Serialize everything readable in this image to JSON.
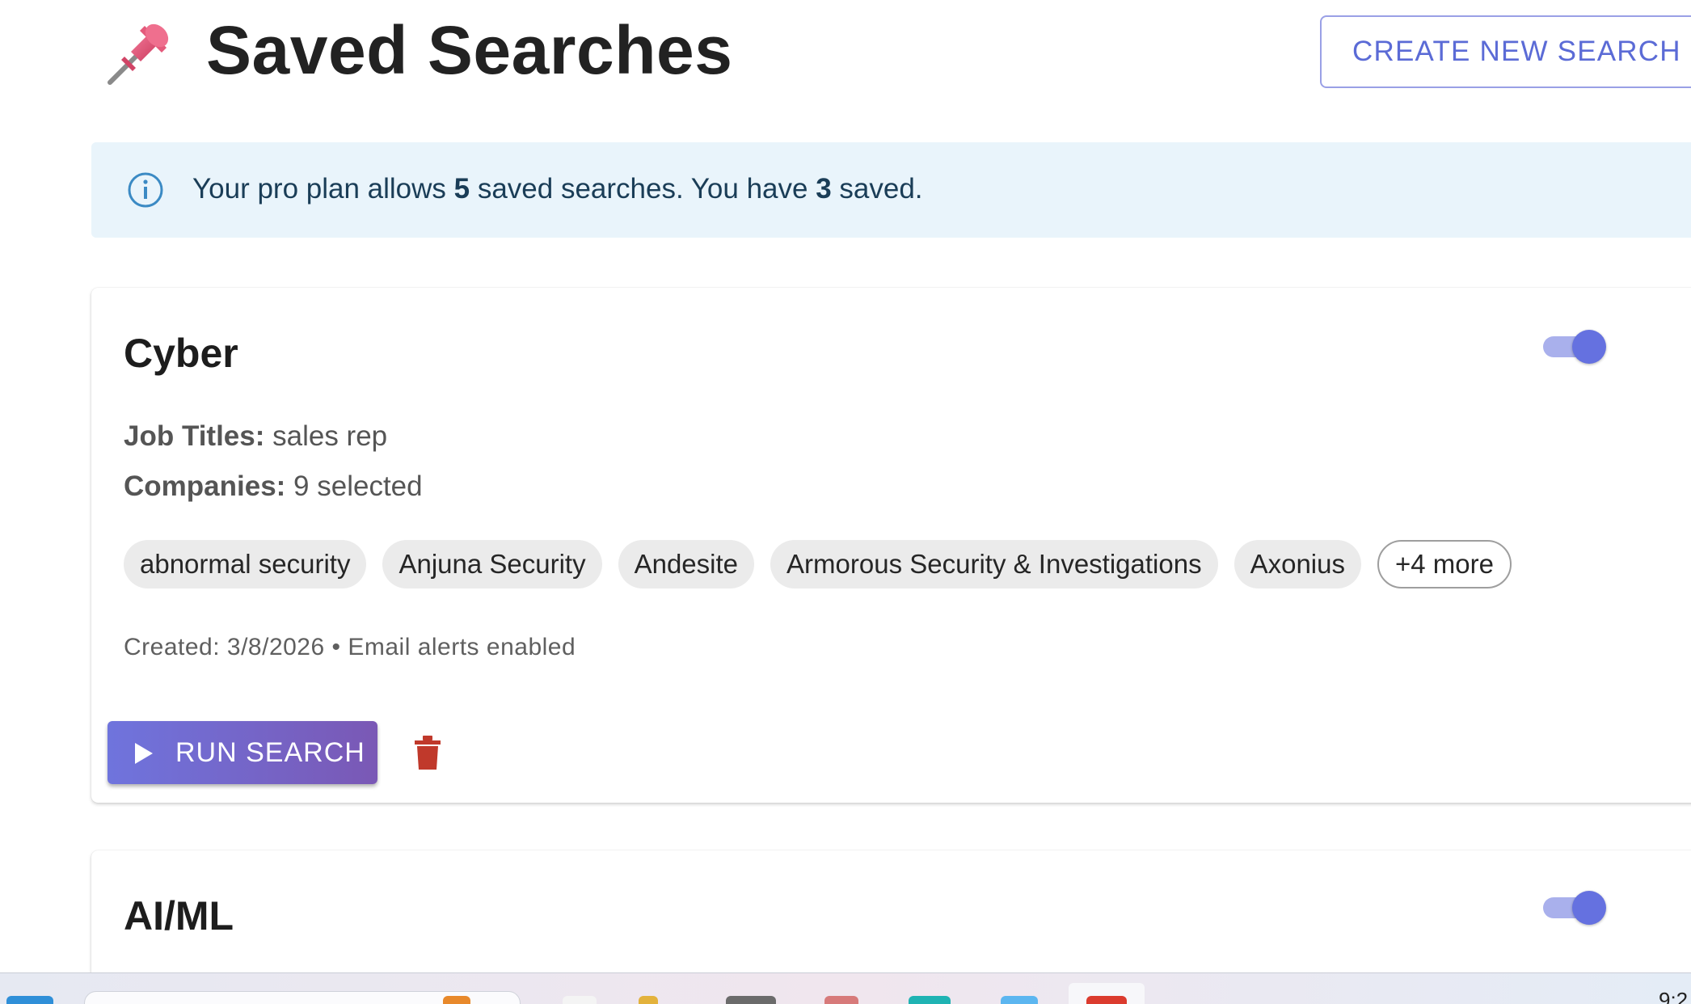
{
  "header": {
    "title": "Saved Searches",
    "pin_icon": "pushpin-icon",
    "create_button": "CREATE NEW SEARCH"
  },
  "info_banner": {
    "text_before": "Your pro plan allows ",
    "allowed": "5",
    "text_middle": " saved searches. You have ",
    "saved": "3",
    "text_after": " saved.",
    "icon": "info-icon"
  },
  "searches": [
    {
      "name": "Cyber",
      "alerts_enabled": true,
      "job_titles_label": "Job Titles:",
      "job_titles_value": "sales rep",
      "companies_label": "Companies:",
      "companies_value": "9 selected",
      "chips": [
        "abnormal security",
        "Anjuna Security",
        "Andesite",
        "Armorous Security & Investigations",
        "Axonius"
      ],
      "more_chip": "+4 more",
      "meta": "Created: 3/8/2026 • Email alerts enabled",
      "run_button": "RUN SEARCH"
    },
    {
      "name": "AI/ML",
      "alerts_enabled": true
    }
  ],
  "taskbar": {
    "clock": "9:2"
  },
  "colors": {
    "accent": "#6571e0",
    "info_bg": "#e9f4fb",
    "trash": "#c0392b"
  }
}
